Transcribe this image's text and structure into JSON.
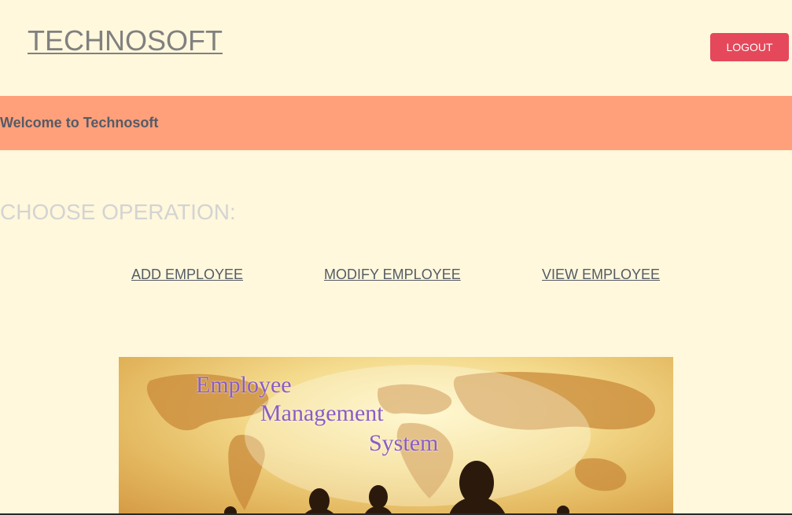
{
  "header": {
    "brand": "TECHNOSOFT",
    "logout_label": "LOGOUT"
  },
  "banner": {
    "welcome_text": "Welcome to Technosoft"
  },
  "operations": {
    "title": "CHOOSE OPERATION:",
    "items": [
      {
        "label": "ADD EMPLOYEE"
      },
      {
        "label": "MODIFY EMPLOYEE"
      },
      {
        "label": "VIEW EMPLOYEE"
      }
    ]
  },
  "hero_image": {
    "lines": [
      "Employee",
      "Management",
      "System"
    ]
  },
  "colors": {
    "background": "#fff8dc",
    "banner": "#ffa07a",
    "logout_button": "#e5485a",
    "heading_text": "#d3d3d3",
    "link_text": "#555b66"
  }
}
